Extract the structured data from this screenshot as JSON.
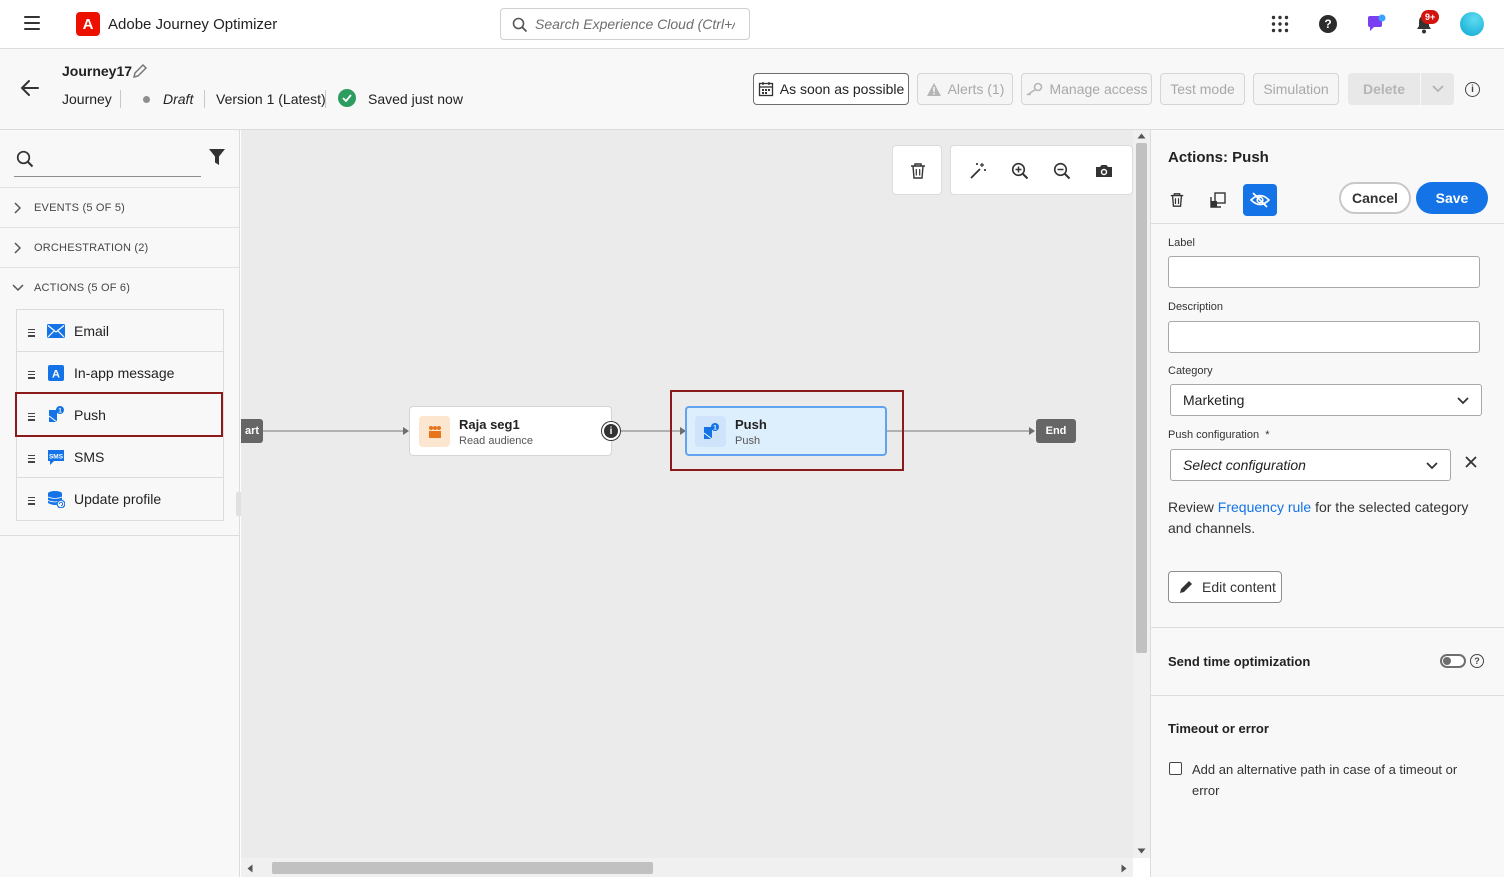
{
  "topbar": {
    "app_title": "Adobe Journey Optimizer",
    "search_placeholder": "Search Experience Cloud (Ctrl+/)",
    "notification_badge": "9+"
  },
  "journey": {
    "name": "Journey17",
    "type": "Journey",
    "status": "Draft",
    "version": "Version 1 (Latest)",
    "saved": "Saved just now",
    "buttons": {
      "schedule": "As soon as possible",
      "alerts": "Alerts (1)",
      "manage_access": "Manage access",
      "test_mode": "Test mode",
      "simulation": "Simulation",
      "delete": "Delete"
    }
  },
  "palette": {
    "search_placeholder": "",
    "sections": {
      "events": "EVENTS (5 OF 5)",
      "orchestration": "ORCHESTRATION (2)",
      "actions": "ACTIONS (5 OF 6)"
    },
    "actions": [
      {
        "label": "Email",
        "icon": "email-icon"
      },
      {
        "label": "In-app message",
        "icon": "in-app-icon"
      },
      {
        "label": "Push",
        "icon": "push-icon"
      },
      {
        "label": "SMS",
        "icon": "sms-icon"
      },
      {
        "label": "Update profile",
        "icon": "update-profile-icon"
      }
    ]
  },
  "canvas": {
    "start_label": "art",
    "end_label": "End",
    "nodes": [
      {
        "title": "Raja seg1",
        "subtitle": "Read audience"
      },
      {
        "title": "Push",
        "subtitle": "Push"
      }
    ]
  },
  "properties": {
    "title": "Actions: Push",
    "cancel_label": "Cancel",
    "save_label": "Save",
    "label_label": "Label",
    "label_value": "",
    "description_label": "Description",
    "description_value": "",
    "category_label": "Category",
    "category_value": "Marketing",
    "push_config_label": "Push configuration",
    "push_config_required": "*",
    "push_config_placeholder": "Select configuration",
    "review_prefix": "Review ",
    "review_link": "Frequency rule",
    "review_suffix": " for the selected category and channels.",
    "edit_content_label": "Edit content",
    "send_time_title": "Send time optimization",
    "send_time_enabled": false,
    "timeout_title": "Timeout or error",
    "timeout_checkbox_label": "Add an alternative path in case of a timeout or error",
    "timeout_checked": false
  },
  "colors": {
    "accent": "#1473e6",
    "adobe_red": "#eb1000",
    "highlight_border": "#8b1a1a",
    "saved_green": "#2d9d5f"
  }
}
